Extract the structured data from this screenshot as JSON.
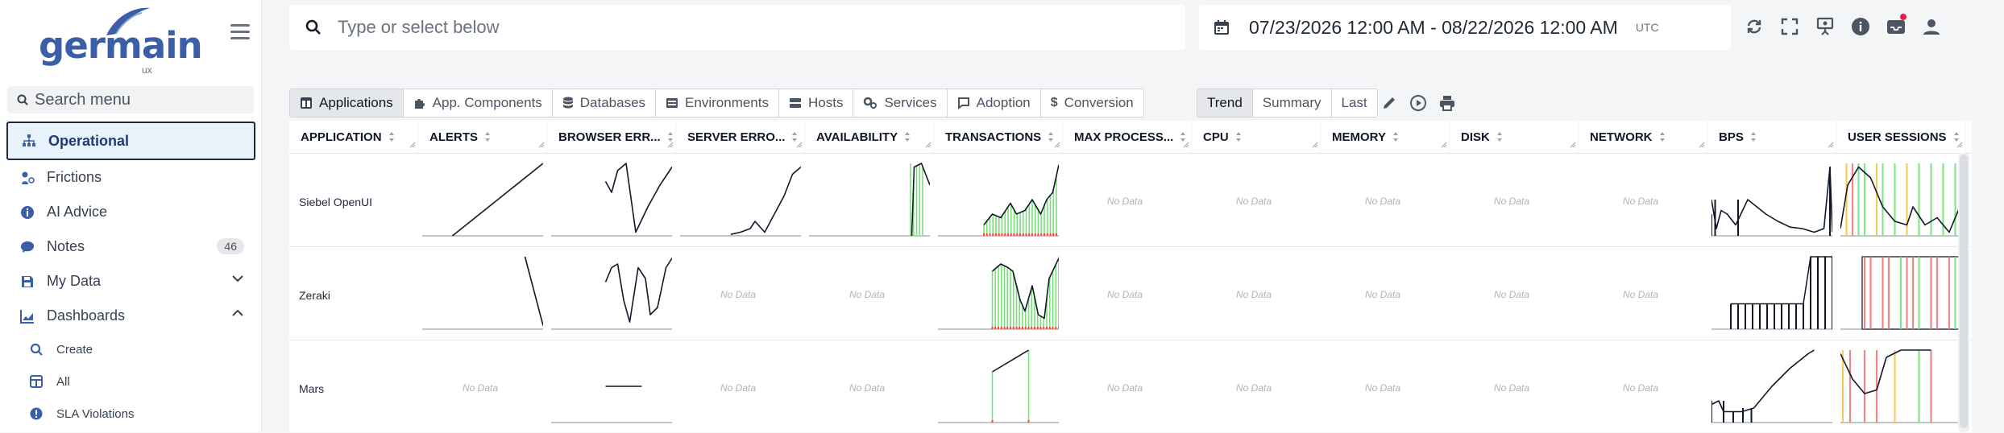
{
  "logo": {
    "text": "germain",
    "sub": "ux"
  },
  "sidebar": {
    "search_placeholder": "Search menu",
    "items": [
      {
        "label": "Operational",
        "icon": "hierarchy-icon",
        "active": true
      },
      {
        "label": "Frictions",
        "icon": "friction-icon"
      },
      {
        "label": "AI Advice",
        "icon": "info-icon"
      },
      {
        "label": "Notes",
        "icon": "chat-icon",
        "badge": "46"
      },
      {
        "label": "My Data",
        "icon": "save-icon",
        "chevron": "down"
      },
      {
        "label": "Dashboards",
        "icon": "chart-icon",
        "chevron": "up"
      }
    ],
    "subitems": [
      {
        "label": "Create",
        "icon": "search-icon"
      },
      {
        "label": "All",
        "icon": "grid-icon"
      },
      {
        "label": "SLA Violations",
        "icon": "alert-icon"
      }
    ]
  },
  "topbar": {
    "search_placeholder": "Type or select below",
    "date_range": "07/23/2026 12:00 AM - 08/22/2026 12:00 AM",
    "timezone": "UTC",
    "icons": [
      "refresh-icon",
      "fullscreen-icon",
      "presentation-icon",
      "info-icon",
      "inbox-icon",
      "user-icon"
    ]
  },
  "tabs": [
    {
      "label": "Applications",
      "icon": "app-icon",
      "active": true
    },
    {
      "label": "App. Components",
      "icon": "puzzle-icon"
    },
    {
      "label": "Databases",
      "icon": "database-icon"
    },
    {
      "label": "Environments",
      "icon": "environment-icon"
    },
    {
      "label": "Hosts",
      "icon": "host-icon"
    },
    {
      "label": "Services",
      "icon": "services-icon"
    },
    {
      "label": "Adoption",
      "icon": "adoption-icon"
    },
    {
      "label": "Conversion",
      "icon": "dollar-icon"
    }
  ],
  "modes": [
    {
      "label": "Trend",
      "active": true
    },
    {
      "label": "Summary"
    },
    {
      "label": "Last"
    }
  ],
  "tools": [
    "pencil-icon",
    "play-icon",
    "print-icon"
  ],
  "columns": [
    "APPLICATION",
    "ALERTS",
    "BROWSER ERR...",
    "SERVER ERRO...",
    "AVAILABILITY",
    "TRANSACTIONS",
    "MAX PROCESS...",
    "CPU",
    "MEMORY",
    "DISK",
    "NETWORK",
    "BPS",
    "USER SESSIONS"
  ],
  "no_data_label": "No Data",
  "rows": [
    {
      "application": "Siebel OpenUI"
    },
    {
      "application": "Zeraki"
    },
    {
      "application": "Mars"
    }
  ],
  "colors": {
    "brand": "#3b5ea8",
    "ok": "#7be07b",
    "warn": "#f2c94c",
    "error": "#f07a7a"
  }
}
